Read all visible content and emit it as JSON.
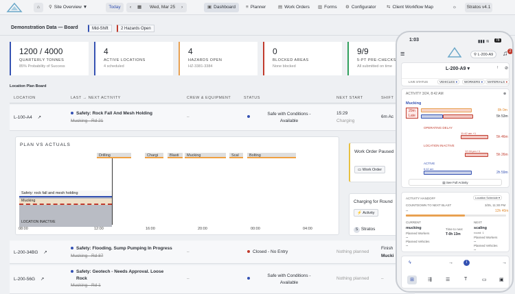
{
  "nav": {
    "site": "Site Overview",
    "today": "Today",
    "date": "Wed, Mar 25",
    "items": [
      "Dashboard",
      "Planner",
      "Work Orders",
      "Forms",
      "Configurator",
      "Client Workflow Map"
    ],
    "version": "Stratos v4.1"
  },
  "subhead": {
    "title": "Demonstration Data — Board",
    "chip_shift": "Mid-Shift",
    "chip_hazards": "2 Hazards Open"
  },
  "kpis": [
    {
      "value": "1200 / 4000",
      "label": "QUARTERLY TONNES",
      "sub": "85% Probability of Success",
      "color": "#3451b2"
    },
    {
      "value": "4",
      "label": "ACTIVE LOCATIONS",
      "sub": "4 scheduled",
      "color": "#3451b2"
    },
    {
      "value": "4",
      "label": "HAZARDS OPEN",
      "sub": "HZ-3381-3384",
      "color": "#e8a050"
    },
    {
      "value": "0",
      "label": "BLOCKED AREAS",
      "sub": "None blocked",
      "color": "#c0392b"
    },
    {
      "value": "9/9",
      "label": "5-PT PRE-CHECKS",
      "sub": "All submitted on time",
      "color": "#2e9e5b"
    }
  ],
  "section": "Location Plan Board",
  "table": {
    "headers": [
      "LOCATION",
      "LAST → NEXT ACTIVITY",
      "CREW & EQUIPMENT",
      "STATUS",
      "NEXT START",
      "SHIFT"
    ],
    "rows": [
      {
        "location": "L-100-A4",
        "activity": "Safety: Rock Fall And Mesh Holding",
        "prev": "Mucking - Rd 21",
        "crew": "–",
        "status": "Safe with Conditions - Available",
        "next": "15:29",
        "next_sub": "Charging",
        "shift": "6m Ac"
      },
      {
        "location": "L-200-34BG",
        "activity": "Safety: Flooding. Sump Pumping In Progress",
        "prev": "Mucking - Rd 87",
        "crew": "–",
        "status": "Closed - No Entry",
        "next": "Nothing planned",
        "shift": "Finish",
        "shift2": "Mucki"
      },
      {
        "location": "L-200-56G",
        "activity": "Safety: Geotech - Needs Approval. Loose",
        "activity2": "Rock",
        "prev": "Mucking - Rd 1",
        "crew": "–",
        "status": "Safe with Conditions - Available",
        "next": "Nothing planned",
        "shift": "–"
      }
    ]
  },
  "pva": {
    "title": "PLAN VS ACTUALS",
    "plan": [
      "Drilling",
      "Chargi",
      "Blasti",
      "Mucking",
      "Scal",
      "Bolting"
    ],
    "actual_1": "Safety: rock fall and mesh holding",
    "actual_2": "Mucking",
    "inactive": "LOCATION INACTIVE",
    "ticks": [
      "08:00",
      "12:00",
      "16:00",
      "20:00",
      "00:00",
      "04:00"
    ]
  },
  "side": {
    "wo_title": "Work Order Paused",
    "wo_btn": "Work Order",
    "charging": "Charging for Round",
    "activity_btn": "Activity",
    "stratos": "Stratos"
  },
  "phone": {
    "time": "1:03",
    "battery": "78",
    "location_chip": "L-200-A9",
    "notif": "2",
    "title": "L-200-A9",
    "live_status": "LIVE STATUS",
    "tabs": [
      "VEHICLES",
      "WORKERS",
      "MATERIALS"
    ],
    "activity_hdr": "ACTIVITY",
    "activity_date": "3/24, 8:42 AM",
    "activity_name": "Mucking",
    "late_badge": "29m Late",
    "late_val_1": "8h 0m",
    "late_val_2": "5h 53m",
    "op_delay": "OPERATING DELAY",
    "op_time": "11:42 am +1",
    "op_val": "5h 46m",
    "inactive": "LOCATION INACTIVE",
    "inactive_time": "12:16 pm +1",
    "inactive_val": "5h 26m",
    "active": "ACTIVE",
    "active_time": "6:42 am",
    "active_val": "2h 59m",
    "full_activity": "See Full Activity",
    "handoff_title": "ACTIVITY HANDOFF",
    "loc_schedule": "Location Schedule",
    "countdown": "COUNTDOWN TO NEXT BLAST",
    "countdown_date": "3/25, 11:30 PM",
    "left_val": "--",
    "right_val": "12h 40m",
    "current_lbl": "CURRENT",
    "current_val": "mucking",
    "next_lbl": "NEXT",
    "next_val": "scaling",
    "round": "round: 1",
    "time_to_next": "Time to next",
    "t_value": "T-0h 13m",
    "planned_workers": "Planned Workers",
    "planned_vehicles": "Planned Vehicles",
    "dash": "--"
  }
}
